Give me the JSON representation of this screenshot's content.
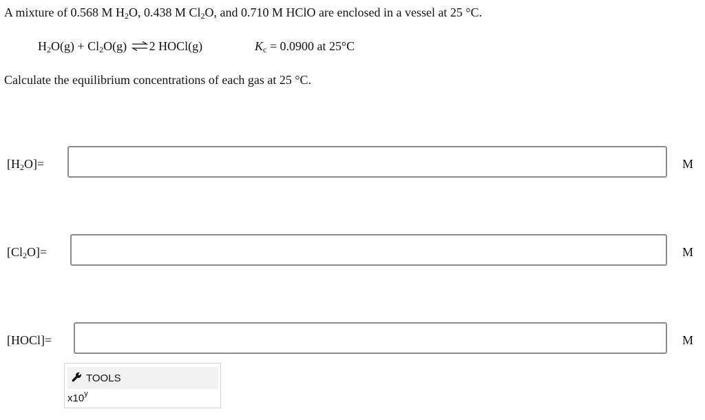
{
  "problem": {
    "intro_prefix": "A mixture of 0.568 M H",
    "intro_sub1": "2",
    "intro_mid1": "O, 0.438 M Cl",
    "intro_sub2": "2",
    "intro_rest": "O, and 0.710 M HClO are enclosed in a vessel at 25 °C.",
    "reaction_h2o_a": "H",
    "reaction_h2o_sub": "2",
    "reaction_h2o_b": "O(g) + Cl",
    "reaction_cl2o_sub": "2",
    "reaction_cl2o_b": "O(g)",
    "reaction_product": "2 HOCl(g)",
    "kc_symbol": "K",
    "kc_sub": "c",
    "kc_value": " = 0.0900 at 25°C",
    "prompt": "Calculate the equilibrium concentrations of each gas at 25 °C."
  },
  "answers": [
    {
      "label_a": "[H",
      "label_sub": "2",
      "label_b": "O]=",
      "value": "",
      "unit": "M"
    },
    {
      "label_a": "[Cl",
      "label_sub": "2",
      "label_b": "O]=",
      "value": "",
      "unit": "M"
    },
    {
      "label_a": "[HOCl]=",
      "label_sub": "",
      "label_b": "",
      "value": "",
      "unit": "M"
    }
  ],
  "tools": {
    "label": "TOOLS",
    "icon": "wrench-icon",
    "sci_base": "x10",
    "sci_exp": "y"
  }
}
